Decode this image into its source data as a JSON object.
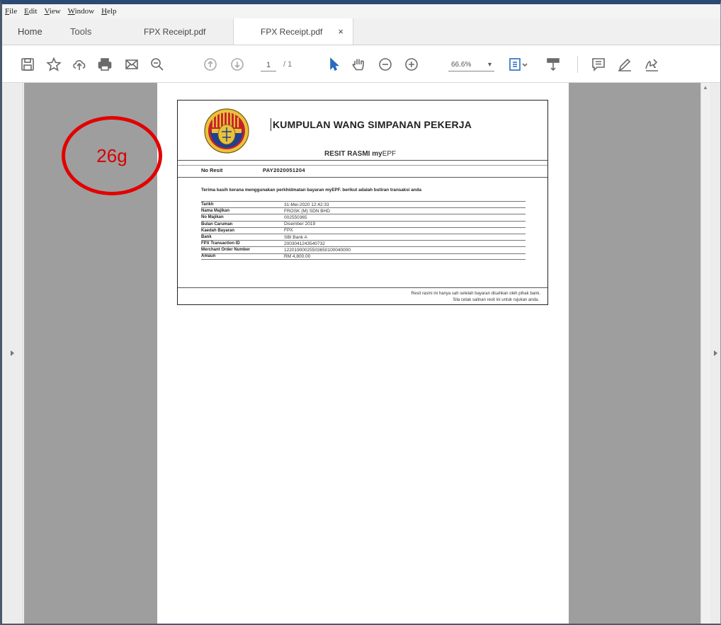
{
  "menu": {
    "items": [
      "File",
      "Edit",
      "View",
      "Window",
      "Help"
    ]
  },
  "tabs": {
    "home": "Home",
    "tools": "Tools",
    "doc1": "FPX Receipt.pdf",
    "doc2": "FPX Receipt.pdf",
    "close": "×"
  },
  "toolbar": {
    "page_current": "1",
    "page_total": "/ 1",
    "zoom": "66.6%",
    "zoom_arrow": "▾",
    "icons": [
      "save-icon",
      "bookmark-star-icon",
      "upload-cloud-icon",
      "print-icon",
      "email-icon",
      "zoom-search-icon",
      "page-up-icon",
      "page-down-icon",
      "select-arrow-icon",
      "hand-tool-icon",
      "zoom-out-icon",
      "zoom-in-icon",
      "page-fit-icon",
      "scroll-mode-icon",
      "comment-icon",
      "highlight-pen-icon",
      "sign-icon"
    ]
  },
  "receipt": {
    "org_name": "KUMPULAN WANG SIMPANAN PEKERJA",
    "title_bold": "RESIT RASMI my",
    "title_light": "EPF",
    "resit_label": "No Resit",
    "resit_value": "PAY2020051204",
    "thanks": "Terima kasih kerana menggunakan perkhidmatan bayaran myEPF. berikut adalah butiran transaksi anda",
    "rows": [
      {
        "label": "Tarikh",
        "value": "31-Mei-2020 12:42:33"
      },
      {
        "label": "Nama Majikan",
        "value": "FROSK (M) SDN BHD"
      },
      {
        "label": "No Majikan",
        "value": "002550365"
      },
      {
        "label": "Bulan Caruman",
        "value": "Disember 2019"
      },
      {
        "label": "Kaedah Bayaran",
        "value": "FPX"
      },
      {
        "label": "Bank",
        "value": "SBI Bank A"
      },
      {
        "label": "FPX Transaction ID",
        "value": "2003041243540732"
      },
      {
        "label": "Merchant Order Number",
        "value": "12201900025503650100040000"
      },
      {
        "label": "Amaun",
        "value": "RM 4,800.00"
      }
    ],
    "footer_line1": "Resit rasmi ini hanya sah setelah bayaran disahkan oleh pihak bank.",
    "footer_line2": "Sila cetak salinan resit ini untuk rujukan anda."
  },
  "annotation": {
    "text": "26g",
    "color": "#e30000"
  },
  "colors": {
    "accent_blue": "#2a6bbf",
    "title_bar": "#2b4a73",
    "viewer_gray": "#9e9e9e"
  }
}
